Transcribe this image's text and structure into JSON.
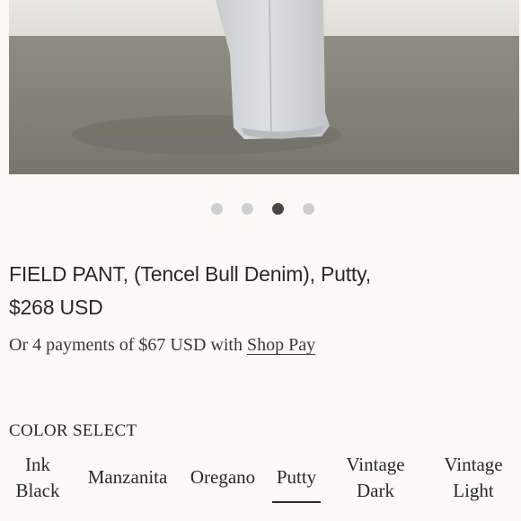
{
  "carousel": {
    "total_slides": 4,
    "active_slide": 3
  },
  "product": {
    "title": "FIELD PANT, (Tencel Bull Denim), Putty,",
    "price": "$268 USD"
  },
  "installments": {
    "prefix": "Or 4 payments of $67 USD with ",
    "link_label": "Shop Pay"
  },
  "color_select": {
    "heading": "COLOR SELECT",
    "options": [
      {
        "line1": "Ink",
        "line2": "Black"
      },
      {
        "line1": "Manzanita",
        "line2": ""
      },
      {
        "line1": "Oregano",
        "line2": ""
      },
      {
        "line1": "Putty",
        "line2": ""
      },
      {
        "line1": "Vintage",
        "line2": "Dark"
      },
      {
        "line1": "Vintage",
        "line2": "Light"
      }
    ],
    "selected": "Putty"
  },
  "colors": {
    "active_dot": "#4b4640",
    "inactive_dot": "#cfcfcf",
    "text": "#2b2926"
  }
}
